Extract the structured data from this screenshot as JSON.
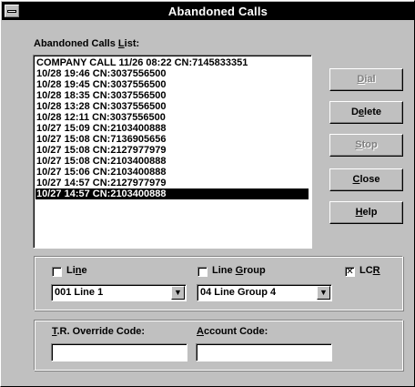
{
  "window": {
    "title": "Abandoned Calls"
  },
  "list": {
    "label_pre": "Abandoned Calls ",
    "label_mnemonic": "L",
    "label_post": "ist:",
    "items": [
      "COMPANY CALL 11/26 08:22 CN:7145833351",
      "10/28 19:46 CN:3037556500",
      "10/28 19:45 CN:3037556500",
      "10/28 18:35 CN:3037556500",
      "10/28 13:28 CN:3037556500",
      "10/28 12:11 CN:3037556500",
      "10/27 15:09 CN:2103400888",
      "10/27 15:08 CN:7136905656",
      "10/27 15:08 CN:2127977979",
      "10/27 15:08 CN:2103400888",
      "10/27 15:06 CN:2103400888",
      "10/27 14:57 CN:2127977979",
      "10/27 14:57 CN:2103400888"
    ],
    "selected_index": 12
  },
  "buttons": {
    "dial": {
      "mn": "D",
      "rest": "ial"
    },
    "delete": {
      "pre": "D",
      "mn": "e",
      "rest": "lete"
    },
    "stop": {
      "mn": "S",
      "rest": "top"
    },
    "close": {
      "mn": "C",
      "rest": "lose"
    },
    "help": {
      "mn": "H",
      "rest": "elp"
    }
  },
  "line": {
    "checkbox": {
      "label_mn": "Li",
      "label_u": "n",
      "label_rest": "e",
      "checked": false
    },
    "line_group_checkbox": {
      "label_pre": "Line ",
      "label_mn": "G",
      "label_rest": "roup",
      "checked": false
    },
    "lcr_checkbox": {
      "label_pre": "LC",
      "label_mn": "R",
      "checked": true,
      "check_mark": "✕"
    },
    "line_select": {
      "value": "001 Line   1"
    },
    "line_group_select": {
      "value": "04 Line Group  4"
    },
    "dropdown_glyph": "▼"
  },
  "codes": {
    "tr_label_mn": "T",
    "tr_label_rest": ".R. Override Code:",
    "tr_value": "",
    "account_label_mn": "A",
    "account_label_rest": "ccount Code:",
    "account_value": ""
  }
}
